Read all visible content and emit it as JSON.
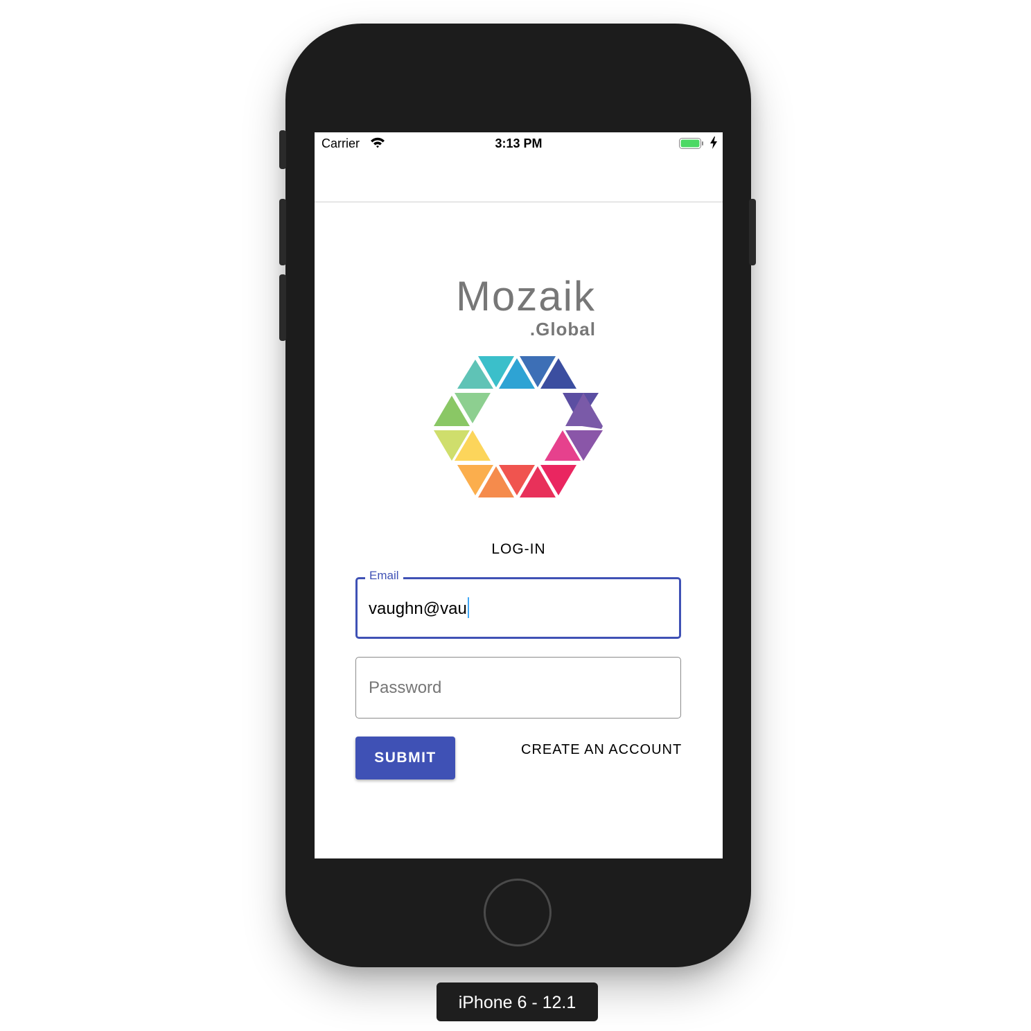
{
  "status_bar": {
    "carrier": "Carrier",
    "time": "3:13 PM",
    "battery_color": "#4cd964"
  },
  "logo": {
    "name": "Mozaik",
    "subtitle": ".Global"
  },
  "login": {
    "title": "LOG-IN",
    "email": {
      "label": "Email",
      "value": "vaughn@vau"
    },
    "password": {
      "placeholder": "Password"
    },
    "submit_label": "SUBMIT",
    "create_account_label": "CREATE AN ACCOUNT"
  },
  "device_label": "iPhone 6 - 12.1",
  "colors": {
    "accent": "#3f51b5",
    "device_frame": "#1c1c1c"
  }
}
